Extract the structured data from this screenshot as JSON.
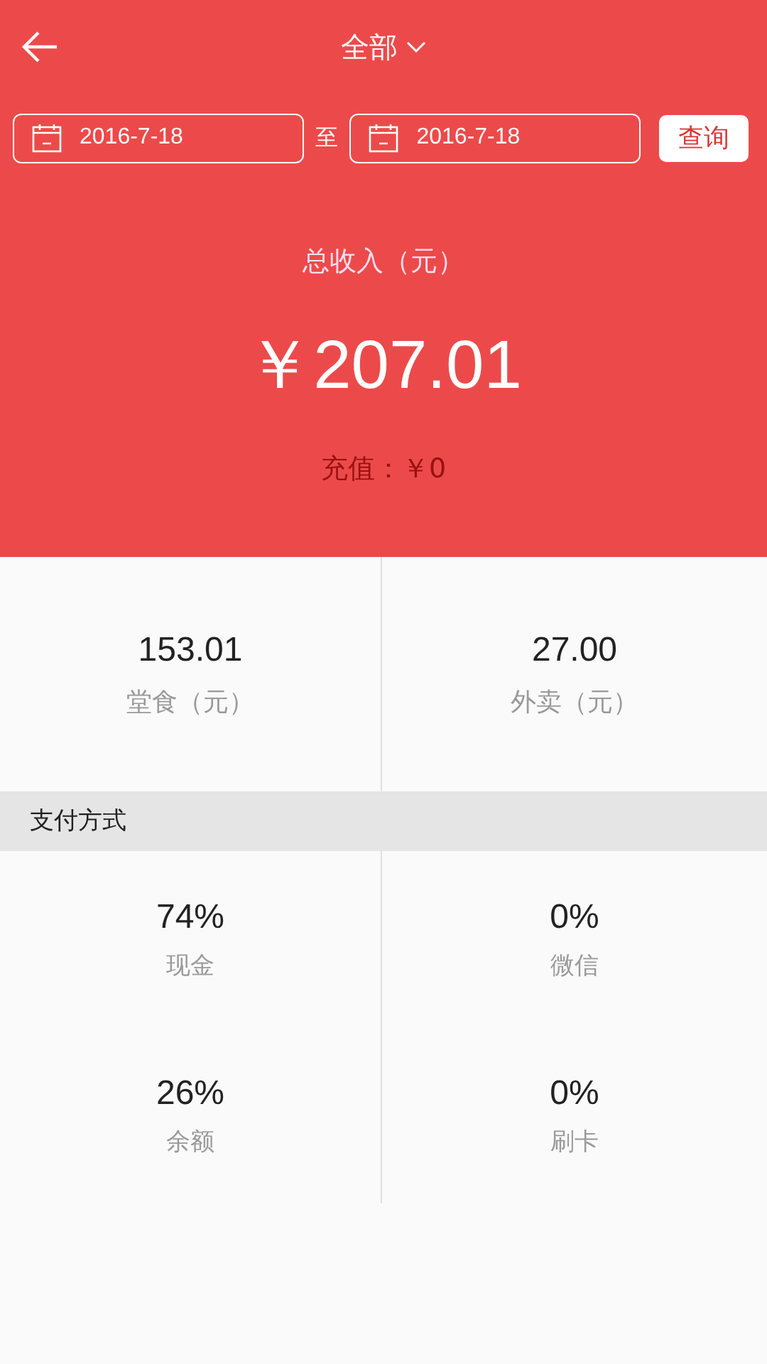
{
  "top_bar": {
    "title": "全部"
  },
  "date_filter": {
    "start": "2016-7-18",
    "separator": "至",
    "end": "2016-7-18",
    "button": "查询"
  },
  "summary": {
    "label": "总收入（元）",
    "amount": "￥207.01",
    "recharge": "充值：￥0"
  },
  "breakdown": [
    {
      "value": "153.01",
      "label": "堂食（元）"
    },
    {
      "value": "27.00",
      "label": "外卖（元）"
    }
  ],
  "payment_section": {
    "title": "支付方式",
    "items": [
      {
        "value": "74%",
        "label": "现金"
      },
      {
        "value": "0%",
        "label": "微信"
      },
      {
        "value": "26%",
        "label": "余额"
      },
      {
        "value": "0%",
        "label": "刷卡"
      }
    ]
  }
}
